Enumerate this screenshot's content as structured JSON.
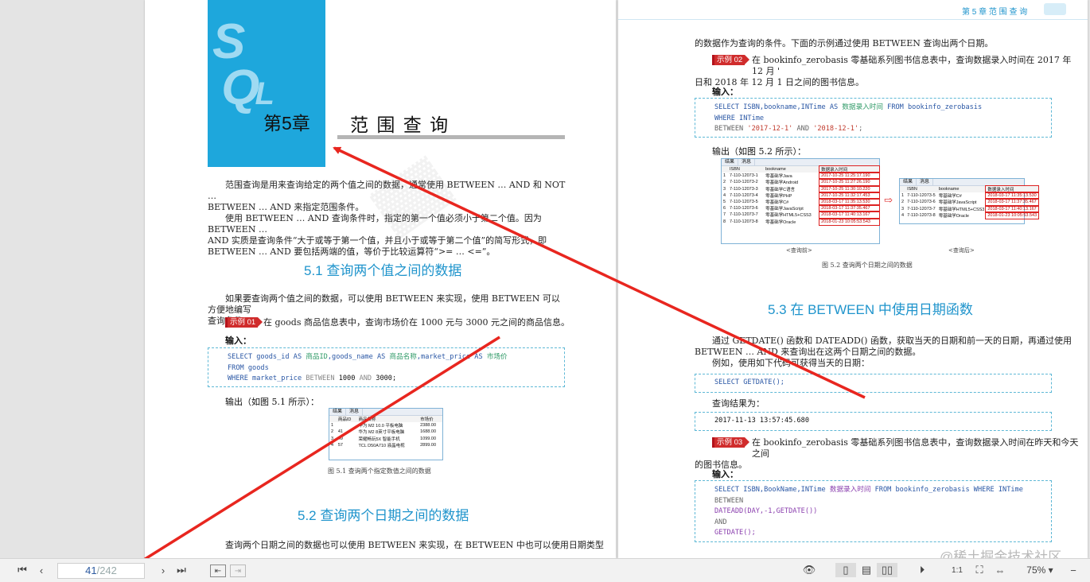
{
  "left_page": {
    "chapter_logo": "SQL",
    "chapter_number": "第5章",
    "chapter_title": "范 围 查 询",
    "intro": [
      "范围查询是用来查询给定的两个值之间的数据，通常使用 BETWEEN … AND 和 NOT …",
      "BETWEEN … AND 来指定范围条件。",
      "使用 BETWEEN … AND 查询条件时，指定的第一个值必须小于第二个值。因为 BETWEEN …",
      "AND 实质是查询条件“大于或等于第一个值，并且小于或等于第二个值”的简写形式，即",
      "BETWEEN … AND 要包括两端的值，等价于比较运算符“>= … <=”。"
    ],
    "section_5_1": "5.1  查询两个值之间的数据",
    "para_5_1": [
      "如果要查询两个值之间的数据，可以使用 BETWEEN 来实现，使用 BETWEEN 可以方便地编写",
      "查询条件。"
    ],
    "example_01_tag": "示例 01",
    "example_01_text": "在 goods 商品信息表中，查询市场价在 1000 元与 3000 元之间的商品信息。",
    "input_label": "输入：",
    "code_01": {
      "l1a": "SELECT goods_id AS ",
      "l1b": "商品ID",
      "l1c": ",goods_name AS ",
      "l1d": "商品名称",
      "l1e": ",market_price AS ",
      "l1f": "市场价",
      "l2": "FROM goods",
      "l3a": "WHERE market_price ",
      "l3b": "BETWEEN",
      "l3c": " 1000 ",
      "l3d": "AND",
      "l3e": " 3000;"
    },
    "output_label": "输出（如图 5.1 所示）：",
    "fig_5_1": {
      "tabs": [
        "结果",
        "消息"
      ],
      "headers": [
        "",
        "商品ID",
        "商品名称",
        "市场价"
      ],
      "rows": [
        [
          "1",
          "",
          "华为 M2 10.0 平板电脑",
          "2388.00"
        ],
        [
          "2",
          "41",
          "华为 M2 8英寸平板电脑",
          "1688.00"
        ],
        [
          "3",
          "49",
          "荣耀畅玩5X 智能手机",
          "1099.00"
        ],
        [
          "4",
          "57",
          "TCL D50A710 液晶电视",
          "2899.00"
        ]
      ],
      "caption": "图 5.1   查询两个指定数值之间的数据"
    },
    "section_5_2": "5.2  查询两个日期之间的数据",
    "para_5_2": "查询两个日期之间的数据也可以使用 BETWEEN 来实现，在 BETWEEN 中也可以使用日期类型"
  },
  "right_page": {
    "running_header": "第 5 章   范 围 查 询",
    "para_top": "的数据作为查询的条件。下面的示例通过使用 BETWEEN 查询出两个日期。",
    "example_02_tag": "示例 02",
    "example_02_text": [
      "在 bookinfo_zerobasis 零基础系列图书信息表中，查询数据录入时间在 2017 年 12 月 '",
      "日和 2018 年 12 月 1 日之间的图书信息。"
    ],
    "input_label": "输入：",
    "code_02": {
      "l1a": "SELECT ISBN,bookname,INTime AS ",
      "l1b": "数据录入时间",
      "l1c": " FROM bookinfo_zerobasis",
      "l2": "WHERE INTime",
      "l3a": "BETWEEN ",
      "l3b": "'2017-12-1'",
      "l3c": " AND ",
      "l3d": "'2018-12-1'",
      "l3e": ";"
    },
    "output_label": "输出（如图 5.2 所示）：",
    "fig_5_2_before": {
      "tabs": [
        "结果",
        "消息"
      ],
      "headers": [
        "",
        "ISBN",
        "bookname",
        "数据录入时间"
      ],
      "rows": [
        [
          "1",
          "7-110-12073-1",
          "零基础学Java",
          "2017-10-25 11:25:17.190"
        ],
        [
          "2",
          "7-110-12073-2",
          "零基础学Android",
          "2017-10-25 11:27:26.190"
        ],
        [
          "3",
          "7-110-12073-3",
          "零基础学C语言",
          "2017-10-25 11:30:10.220"
        ],
        [
          "4",
          "7-110-12073-4",
          "零基础学PHP",
          "2017-10-25 11:32:17.453"
        ],
        [
          "5",
          "7-110-12073-5",
          "零基础学C#",
          "2018-03-17 11:35:13.530"
        ],
        [
          "6",
          "7-110-12073-6",
          "零基础学JavaScript",
          "2018-03-17 11:37:35.467"
        ],
        [
          "7",
          "7-110-12073-7",
          "零基础学HTML5+CSS3",
          "2018-03-17 11:40:13.167"
        ],
        [
          "8",
          "7-110-12073-8",
          "零基础学Oracle",
          "2018-01-23 10:05:53.543"
        ]
      ],
      "sub": "<查询前>"
    },
    "fig_5_2_after": {
      "tabs": [
        "结果",
        "消息"
      ],
      "headers": [
        "",
        "ISBN",
        "bookname",
        "数据录入时间"
      ],
      "rows": [
        [
          "1",
          "7-110-12073-5",
          "零基础学C#",
          "2018-03-17 11:35:13.530"
        ],
        [
          "2",
          "7-110-12073-6",
          "零基础学JavaScript",
          "2018-03-17 11:37:35.467"
        ],
        [
          "3",
          "7-110-12073-7",
          "零基础学HTML5+CSS3",
          "2018-03-17 11:40:13.167"
        ],
        [
          "4",
          "7-110-12073-8",
          "零基础学Oracle",
          "2018-01-23 10:05:53.543"
        ]
      ],
      "sub": "<查询后>"
    },
    "fig_5_2_caption": "图 5.2   查询两个日期之间的数据",
    "section_5_3": "5.3  在 BETWEEN 中使用日期函数",
    "para_5_3": [
      "通过 GETDATE() 函数和 DATEADD() 函数，获取当天的日期和前一天的日期，再通过使用",
      "BETWEEN … AND 来查询出在这两个日期之间的数据。",
      "例如，使用如下代码可获得当天的日期："
    ],
    "code_getdate": "SELECT GETDATE();",
    "result_label": "查询结果为：",
    "result_value": "2017-11-13 13:57:45.680",
    "example_03_tag": "示例 03",
    "example_03_text": [
      "在 bookinfo_zerobasis 零基础系列图书信息表中，查询数据录入时间在昨天和今天之间",
      "的图书信息。"
    ],
    "code_03": {
      "l1a": "SELECT ISBN,BookName,INTime ",
      "l1b": "数据录入时间",
      "l1c": " FROM bookinfo_zerobasis WHERE INTime",
      "l2": "BETWEEN",
      "l3": "DATEADD(DAY,-1,GETDATE())",
      "l4": "AND",
      "l5": "GETDATE();"
    },
    "watermark_site": "@稀土掘金技术社区"
  },
  "toolbar": {
    "current_page": "41",
    "total_pages": "/242",
    "zoom": "75%"
  },
  "colors": {
    "accent": "#1f94cc",
    "arrow": "#e8261f",
    "tag": "#d02c2c"
  }
}
